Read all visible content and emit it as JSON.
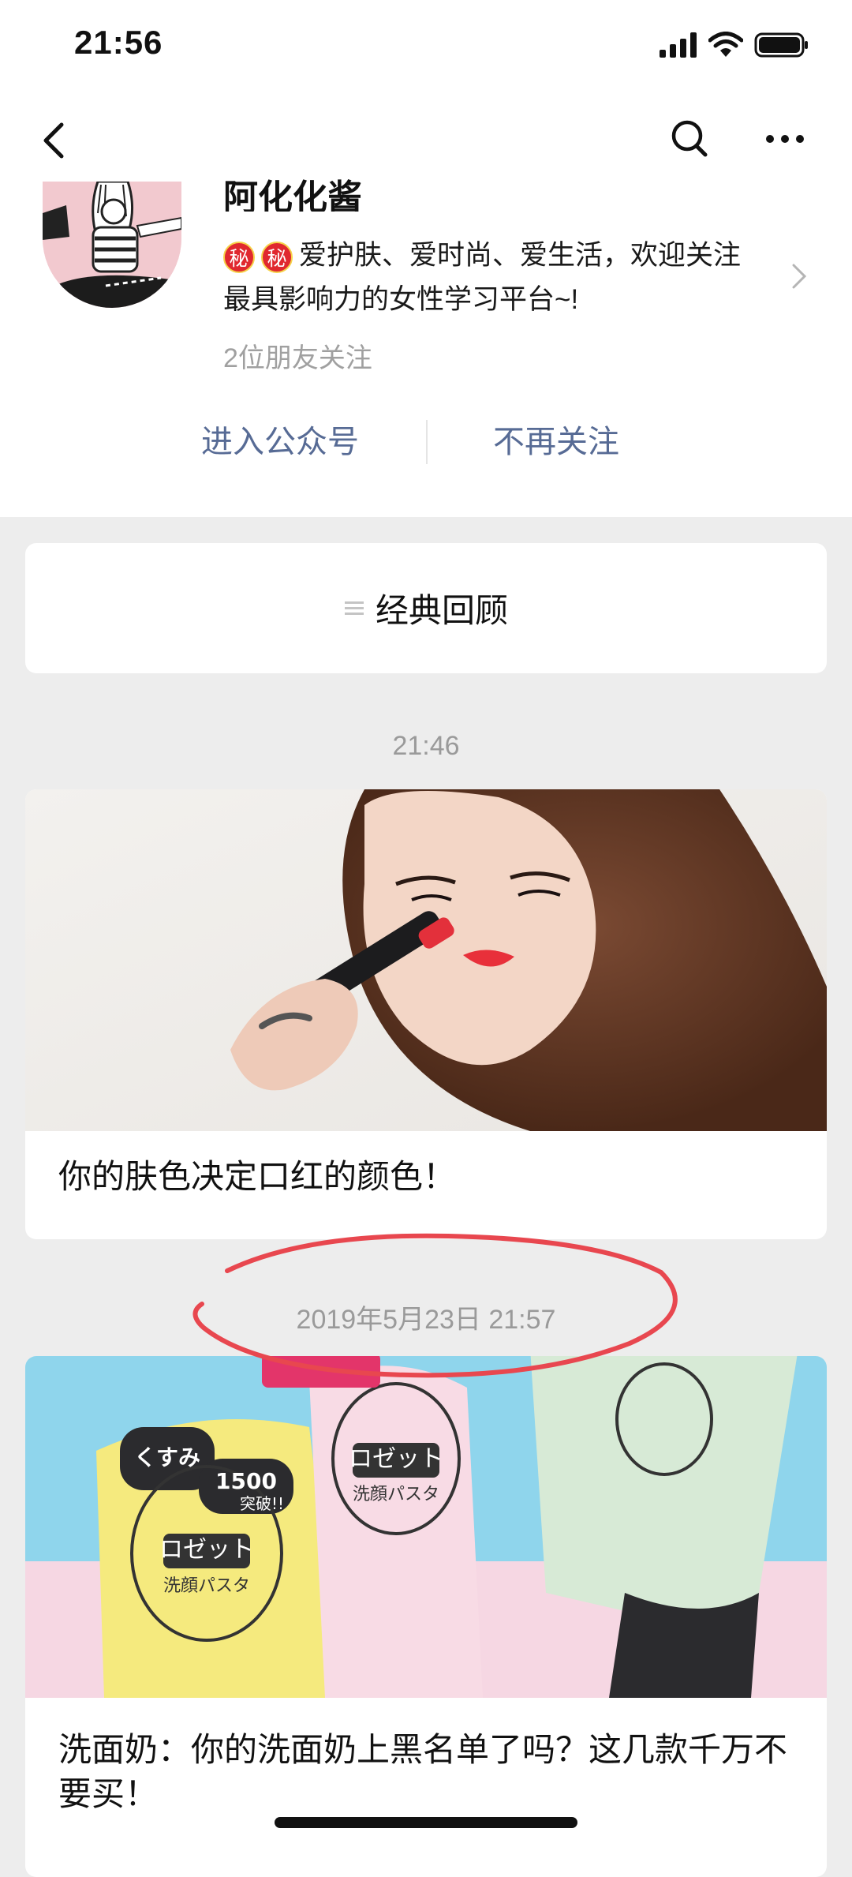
{
  "status": {
    "time": "21:56"
  },
  "nav": {
    "back": "back",
    "search": "search",
    "more": "more"
  },
  "account": {
    "name": "阿化化酱",
    "badge_char": "秘",
    "intro_line1": "爱护肤、爱时尚、爱生活，欢迎关注",
    "intro_line2": "最具影响力的女性学习平台~!",
    "friends": "2位朋友关注"
  },
  "actions": {
    "enter": "进入公众号",
    "unfollow": "不再关注"
  },
  "menu": {
    "label": "经典回顾"
  },
  "articles": [
    {
      "time": "21:46",
      "title": "你的肤色决定口红的颜色！",
      "image": "woman-applying-red-lipstick"
    },
    {
      "time": "2019年5月23日 21:57",
      "title": "洗面奶：你的洗面奶上黑名单了吗？这几款千万不要买！",
      "image": "facial-cleanser-tubes"
    }
  ],
  "product_text": {
    "brand": "ロゼット",
    "subtitle": "洗顔パスタ",
    "sticker1": "くすみ",
    "sticker2": "1500",
    "sticker3": "突破!!"
  },
  "colors": {
    "link": "#576b95",
    "bg": "#ededed",
    "annotation": "#e8474f"
  },
  "icons": [
    "signal-icon",
    "wifi-icon",
    "battery-icon",
    "back-arrow-icon",
    "search-icon",
    "more-icon",
    "chevron-right-icon",
    "menu-list-icon"
  ]
}
